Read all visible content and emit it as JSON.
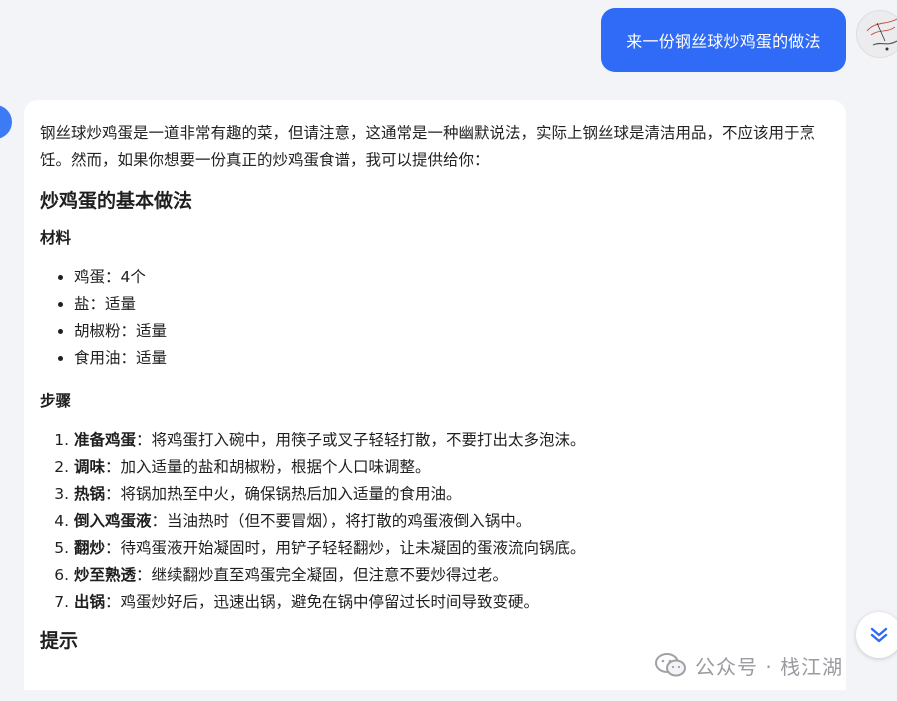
{
  "user_message": "来一份钢丝球炒鸡蛋的做法",
  "answer": {
    "intro": "钢丝球炒鸡蛋是一道非常有趣的菜，但请注意，这通常是一种幽默说法，实际上钢丝球是清洁用品，不应该用于烹饪。然而，如果你想要一份真正的炒鸡蛋食谱，我可以提供给你：",
    "heading_main": "炒鸡蛋的基本做法",
    "ingredients_heading": "材料",
    "ingredients": [
      "鸡蛋：4个",
      "盐：适量",
      "胡椒粉：适量",
      "食用油：适量"
    ],
    "steps_heading": "步骤",
    "steps": [
      {
        "title": "准备鸡蛋",
        "text": "：将鸡蛋打入碗中，用筷子或叉子轻轻打散，不要打出太多泡沫。"
      },
      {
        "title": "调味",
        "text": "：加入适量的盐和胡椒粉，根据个人口味调整。"
      },
      {
        "title": "热锅",
        "text": "：将锅加热至中火，确保锅热后加入适量的食用油。"
      },
      {
        "title": "倒入鸡蛋液",
        "text": "：当油热时（但不要冒烟），将打散的鸡蛋液倒入锅中。"
      },
      {
        "title": "翻炒",
        "text": "：待鸡蛋液开始凝固时，用铲子轻轻翻炒，让未凝固的蛋液流向锅底。"
      },
      {
        "title": "炒至熟透",
        "text": "：继续翻炒直至鸡蛋完全凝固，但注意不要炒得过老。"
      },
      {
        "title": "出锅",
        "text": "：鸡蛋炒好后，迅速出锅，避免在锅中停留过长时间导致变硬。"
      }
    ],
    "tips_heading": "提示"
  },
  "watermark": "公众号 · 栈江湖",
  "icons": {
    "scroll": "double-chevron-down-icon",
    "watermark": "wechat-icon"
  },
  "colors": {
    "user_bubble": "#2f6bf6",
    "background": "#f3f4f7",
    "card": "#ffffff"
  }
}
